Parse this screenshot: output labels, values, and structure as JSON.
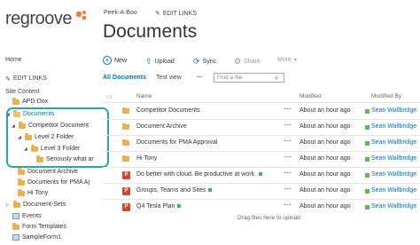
{
  "header": {
    "logo_text": "regroove",
    "breadcrumb": "Peek-A-Boo",
    "edit_links_top": "EDIT LINKS",
    "title": "Documents"
  },
  "nav": {
    "home": "Home",
    "edit_links": "EDIT LINKS",
    "site_content": "Site Content",
    "apd_dox": "APD-Dox",
    "tree": [
      {
        "label": "Documents",
        "selected": true
      },
      {
        "label": "Competitor Document"
      },
      {
        "label": "Level 2 Folder"
      },
      {
        "label": "Level 3 Folder"
      },
      {
        "label": "Seriously what ar"
      },
      {
        "label": "Document Archive"
      },
      {
        "label": "Documents for PMA Aj"
      },
      {
        "label": "Hi Tony"
      },
      {
        "label": "Document-Sets"
      },
      {
        "label": "Events"
      },
      {
        "label": "Form Templates"
      },
      {
        "label": "SampleForm1"
      }
    ]
  },
  "toolbar": {
    "new": "New",
    "upload": "Upload",
    "sync": "Sync",
    "share": "Share",
    "more": "More"
  },
  "views": {
    "all_documents": "All Documents",
    "test_view": "Test view",
    "more": "...",
    "search_placeholder": "Find a file"
  },
  "table": {
    "headers": {
      "name": "Name",
      "modified": "Modified",
      "modified_by": "Modified By"
    },
    "rows": [
      {
        "name": "Competitor Documents",
        "modified": "About an hour ago",
        "by": "Sean Wallbridge",
        "icon": "folder"
      },
      {
        "name": "Document Archive",
        "modified": "About an hour ago",
        "by": "Sean Wallbridge",
        "icon": "folder"
      },
      {
        "name": "Documents for PMA Approval",
        "modified": "About an hour ago",
        "by": "Sean Wallbridge",
        "icon": "folder"
      },
      {
        "name": "Hi Tony",
        "modified": "About an hour ago",
        "by": "Sean Wallbridge",
        "icon": "folder"
      },
      {
        "name": "Do better with cloud. Be productive at work.",
        "modified": "About an hour ago",
        "by": "Sean Wallbridge",
        "icon": "powerpoint"
      },
      {
        "name": "Groups, Teams and Sites",
        "modified": "About an hour ago",
        "by": "Sean Wallbridge",
        "icon": "powerpoint"
      },
      {
        "name": "Q4 Tesla Plan",
        "modified": "About an hour ago",
        "by": "Sean Wallbridge",
        "icon": "powerpoint"
      }
    ],
    "drag_hint": "Drag files here to upload"
  },
  "colors": {
    "accent": "#0072c6",
    "highlight": "#2ba79c",
    "logo_orange": "#f4793b",
    "folder": "#e8b14f"
  }
}
